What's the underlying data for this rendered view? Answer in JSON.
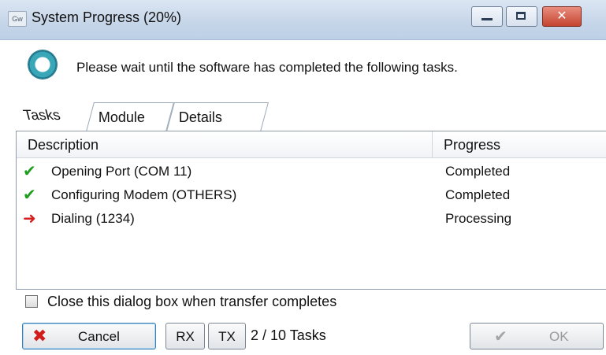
{
  "window": {
    "title": "System Progress (20%)",
    "app_icon_label": "Gw",
    "close_glyph": "✕"
  },
  "notice": {
    "text": "Please wait until the software has completed the following tasks."
  },
  "tabs": [
    {
      "label": "Tasks",
      "selected": true
    },
    {
      "label": "Module",
      "selected": false
    },
    {
      "label": "Details",
      "selected": false
    }
  ],
  "table": {
    "columns": [
      "Description",
      "Progress"
    ],
    "rows": [
      {
        "icon": "check-icon",
        "description": "Opening Port (COM 11)",
        "progress": "Completed"
      },
      {
        "icon": "check-icon",
        "description": "Configuring Modem (OTHERS)",
        "progress": "Completed"
      },
      {
        "icon": "arrow-right-icon",
        "description": "Dialing (1234)",
        "progress": "Processing"
      }
    ]
  },
  "options": {
    "close_on_complete_label": "Close this dialog box when transfer completes",
    "close_on_complete_checked": false
  },
  "footer": {
    "cancel_label": "Cancel",
    "rx_label": "RX",
    "tx_label": "TX",
    "task_count": "2 / 10 Tasks",
    "ok_label": "OK"
  },
  "colors": {
    "success": "#1f9d1f",
    "processing": "#d42020",
    "accent": "#3c7fb1"
  }
}
